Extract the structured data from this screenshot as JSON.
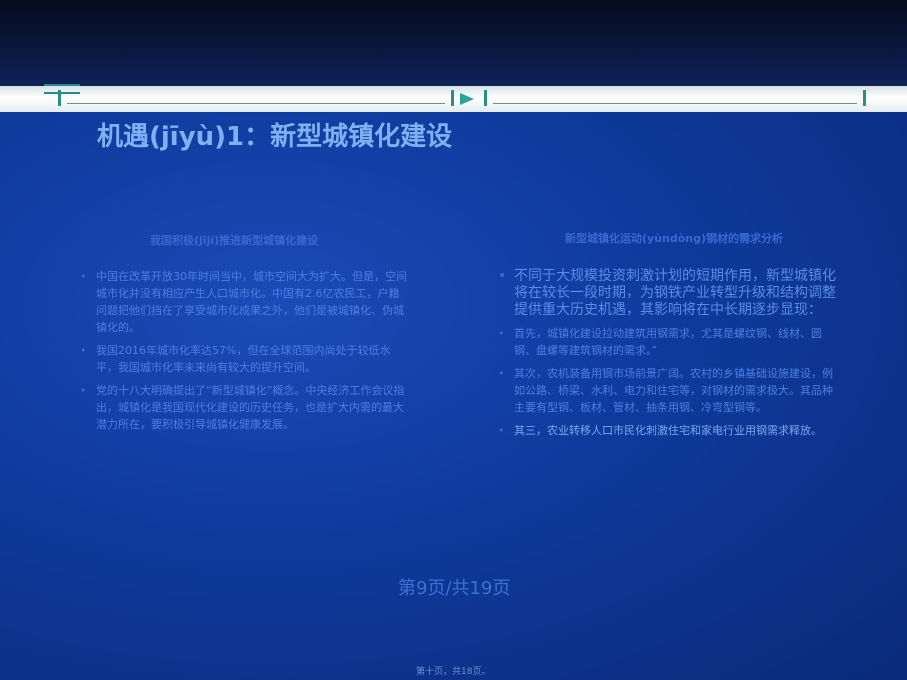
{
  "slide": {
    "title": "机遇(jīyù)1：新型城镇化建设",
    "left": {
      "heading": "我国积极(jījí)推进新型城镇化建设",
      "bullets": [
        "中国在改革开放30年时间当中，城市空间大为扩大。但是，空间城市化并没有相应产生人口城市化。中国有2.6亿农民工，户籍问题把他们挡在了享受城市化成果之外，他们是被城镇化、伪城镇化的。",
        "我国2016年城市化率达57%，但在全球范围内尚处于较低水平，我国城市化率未来尚有较大的提升空间。",
        "党的十八大明确提出了“新型城镇化”概念。中央经济工作会议指出，城镇化是我国现代化建设的历史任务，也是扩大内需的最大潜力所在，要积极引导城镇化健康发展。"
      ]
    },
    "right": {
      "heading": "新型城镇化运动(yùndòng)钢材的需求分析",
      "intro": "不同于大规模投资刺激计划的短期作用，新型城镇化将在较长一段时期，为钢铁产业转型升级和结构调整提供重大历史机遇，其影响将在中长期逐步显现：",
      "bullets": [
        "首先，城镇化建设拉动建筑用钢需求，尤其是螺纹钢、线材、圆钢、盘螺等建筑钢材的需求。”",
        "其次，农机装备用钢市场前景广阔。农村的乡镇基础设施建设，例如公路、桥梁、水利、电力和住宅等，对钢材的需求极大。其品种主要有型钢、板材、管材、抽条用钢、冷弯型钢等。",
        "其三，农业转移人口市民化刺激住宅和家电行业用钢需求释放。"
      ]
    },
    "page_indicator": "第9页/共19页",
    "footer": "第十页，共18页。"
  }
}
